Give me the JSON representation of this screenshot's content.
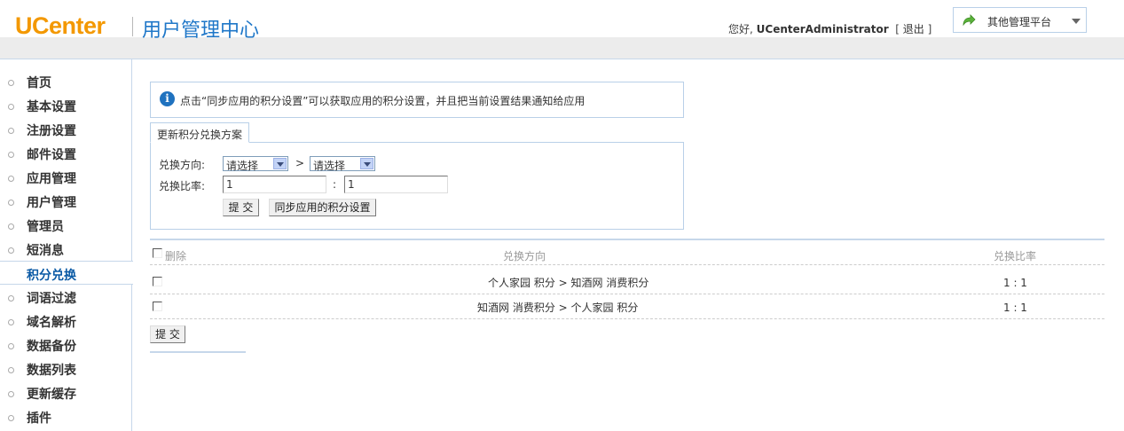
{
  "header": {
    "logo": "UCenter",
    "title": "用户管理中心",
    "greeting": "您好,",
    "username": "UCenterAdministrator",
    "logout_open": "[",
    "logout": "退出",
    "logout_close": "]",
    "platform_label": "其他管理平台"
  },
  "sidebar": {
    "items": [
      {
        "label": "首页"
      },
      {
        "label": "基本设置"
      },
      {
        "label": "注册设置"
      },
      {
        "label": "邮件设置"
      },
      {
        "label": "应用管理"
      },
      {
        "label": "用户管理"
      },
      {
        "label": "管理员"
      },
      {
        "label": "短消息"
      },
      {
        "label": "积分兑换"
      },
      {
        "label": "词语过滤"
      },
      {
        "label": "域名解析"
      },
      {
        "label": "数据备份"
      },
      {
        "label": "数据列表"
      },
      {
        "label": "更新缓存"
      },
      {
        "label": "插件"
      }
    ],
    "active": "积分兑换"
  },
  "notice": {
    "text": "点击“同步应用的积分设置”可以获取应用的积分设置，并且把当前设置结果通知给应用"
  },
  "form": {
    "tab_label": "更新积分兑换方案",
    "direction_label": "兑换方向:",
    "from_select": "请选择",
    "arrow": ">",
    "to_select": "请选择",
    "ratio_label": "兑换比率:",
    "ratio_from": "1",
    "ratio_sep": ":",
    "ratio_to": "1",
    "submit_label": "提 交",
    "sync_label": "同步应用的积分设置"
  },
  "table": {
    "headers": {
      "delete": "删除",
      "direction": "兑换方向",
      "ratio": "兑换比率"
    },
    "rows": [
      {
        "direction": "个人家园 积分 > 知酒网 消费积分",
        "ratio": "1 : 1"
      },
      {
        "direction": "知酒网 消费积分 > 个人家园 积分",
        "ratio": "1 : 1"
      }
    ],
    "submit_label": "提 交"
  },
  "colors": {
    "logo": "#f39800",
    "title": "#1f77c8",
    "active_menu": "#0b5aa5",
    "border": "#b9d0e8"
  }
}
